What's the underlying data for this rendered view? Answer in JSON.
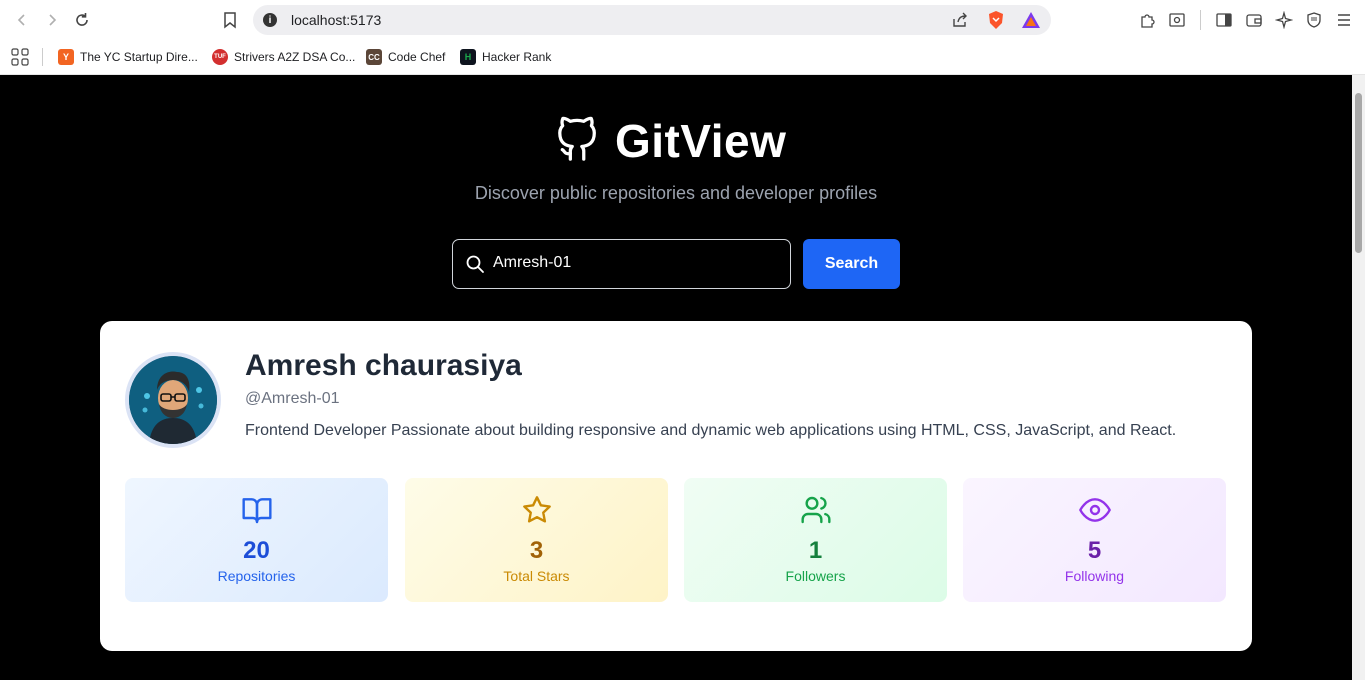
{
  "browser": {
    "url": "localhost:5173",
    "bookmarks": [
      {
        "label": "The YC Startup Dire...",
        "favicon": "Y",
        "color": "#f26522"
      },
      {
        "label": "Strivers A2Z DSA Co...",
        "favicon": "TUF",
        "color": "#d32f2f"
      },
      {
        "label": "Code Chef",
        "favicon": "CC",
        "color": "#5b4638"
      },
      {
        "label": "Hacker Rank",
        "favicon": "H",
        "color": "#1ba94c"
      }
    ]
  },
  "header": {
    "title": "GitView",
    "subtitle": "Discover public repositories and developer profiles"
  },
  "search": {
    "value": "Amresh-01",
    "button_label": "Search"
  },
  "profile": {
    "name": "Amresh chaurasiya",
    "handle": "@Amresh-01",
    "bio": "Frontend Developer Passionate about building responsive and dynamic web applications using HTML, CSS, JavaScript, and React."
  },
  "stats": [
    {
      "value": "20",
      "label": "Repositories",
      "icon": "book-open-icon",
      "color": "#1d4ed8",
      "label_color": "#2563eb",
      "bg": "linear-gradient(135deg,#eff6ff,#dbeafe)"
    },
    {
      "value": "3",
      "label": "Total Stars",
      "icon": "star-icon",
      "color": "#a16207",
      "label_color": "#ca8a04",
      "bg": "linear-gradient(135deg,#fefce8,#fef3c7)"
    },
    {
      "value": "1",
      "label": "Followers",
      "icon": "users-icon",
      "color": "#15803d",
      "label_color": "#16a34a",
      "bg": "linear-gradient(135deg,#f0fdf4,#dcfce7)"
    },
    {
      "value": "5",
      "label": "Following",
      "icon": "eye-icon",
      "color": "#6b21a8",
      "label_color": "#9333ea",
      "bg": "linear-gradient(135deg,#faf5ff,#f3e8ff)"
    }
  ]
}
